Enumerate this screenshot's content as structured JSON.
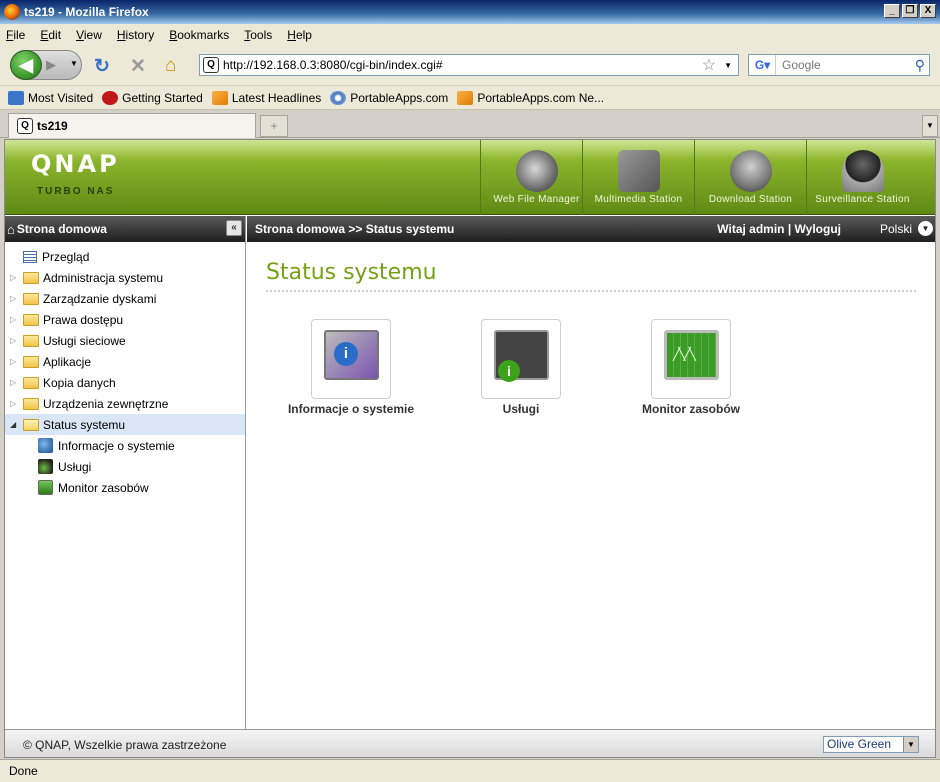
{
  "window": {
    "title": "ts219 - Mozilla Firefox",
    "minimize": "_",
    "restore": "❐",
    "close": "X"
  },
  "menu": [
    "File",
    "Edit",
    "View",
    "History",
    "Bookmarks",
    "Tools",
    "Help"
  ],
  "nav": {
    "url": "http://192.168.0.3:8080/cgi-bin/index.cgi#",
    "search_placeholder": "Google"
  },
  "bookmarks": [
    "Most Visited",
    "Getting Started",
    "Latest Headlines",
    "PortableApps.com",
    "PortableApps.com Ne..."
  ],
  "tab": {
    "title": "ts219",
    "new_tab": "+"
  },
  "qnap": {
    "logo": "QNAP",
    "subtitle": "TURBO NAS",
    "apps": [
      "Web File Manager",
      "Multimedia Station",
      "Download Station",
      "Surveillance Station"
    ]
  },
  "left": {
    "header": "Strona domowa",
    "collapse": "«",
    "tree": [
      {
        "label": "Przegląd"
      },
      {
        "label": "Administracja systemu"
      },
      {
        "label": "Zarządzanie dyskami"
      },
      {
        "label": "Prawa dostępu"
      },
      {
        "label": "Usługi sieciowe"
      },
      {
        "label": "Aplikacje"
      },
      {
        "label": "Kopia danych"
      },
      {
        "label": "Urządzenia zewnętrzne"
      },
      {
        "label": "Status systemu"
      }
    ],
    "children": [
      "Informacje o systemie",
      "Usługi",
      "Monitor zasobów"
    ]
  },
  "content": {
    "breadcrumb": "Strona domowa >> Status systemu",
    "welcome": "Witaj admin",
    "logout": "Wyloguj",
    "language": "Polski",
    "title": "Status systemu",
    "tiles": [
      "Informacje o systemie",
      "Usługi",
      "Monitor zasobów"
    ]
  },
  "footer": {
    "copyright": "© QNAP, Wszelkie prawa zastrzeżone",
    "theme": "Olive Green"
  },
  "status": "Done"
}
